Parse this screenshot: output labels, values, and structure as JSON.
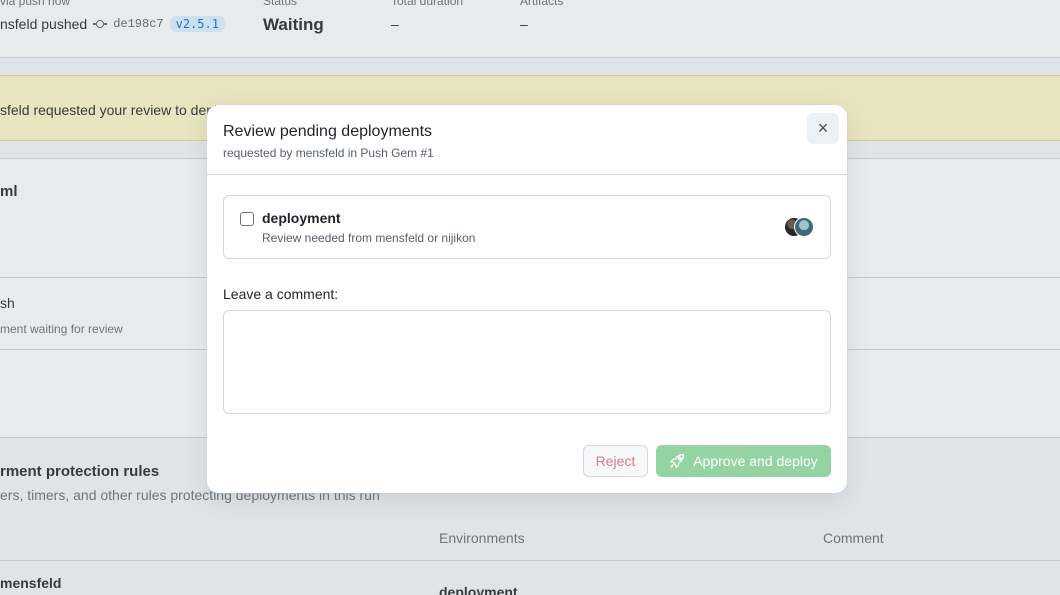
{
  "run_header": {
    "trigger_label": "via push now",
    "trigger_text": "nsfeld pushed",
    "commit_sha": "de198c7",
    "tag": "v2.5.1",
    "status_label": "Status",
    "status_value": "Waiting",
    "duration_label": "Total duration",
    "duration_value": "–",
    "artifacts_label": "Artifacts",
    "artifacts_value": "–"
  },
  "banner": {
    "text": "sfeld requested your review to depl"
  },
  "workflow_card": {
    "title": "ml",
    "job_name": "sh",
    "job_status": "ment waiting for review"
  },
  "protection": {
    "title": "rment protection rules",
    "subtitle": "ers, timers, and other rules protecting deployments in this run",
    "columns": [
      "Environments",
      "Comment"
    ],
    "rows": [
      {
        "user": "mensfeld",
        "environment": "deployment"
      }
    ]
  },
  "modal": {
    "title": "Review pending deployments",
    "subtitle": "requested by mensfeld in Push Gem #1",
    "close_label": "×",
    "environment": {
      "name": "deployment",
      "description": "Review needed from mensfeld or nijikon",
      "checked": false
    },
    "comment_label": "Leave a comment:",
    "comment_value": "",
    "reject_label": "Reject",
    "approve_label": "Approve and deploy"
  },
  "icons": {
    "close": "close-icon",
    "rocket": "rocket-icon",
    "commit": "git-commit-icon"
  },
  "colors": {
    "approve_disabled": "#94d3a2",
    "reject_text": "#e5787e",
    "banner_bg": "#fff8c5",
    "tag_text": "#0969da"
  }
}
